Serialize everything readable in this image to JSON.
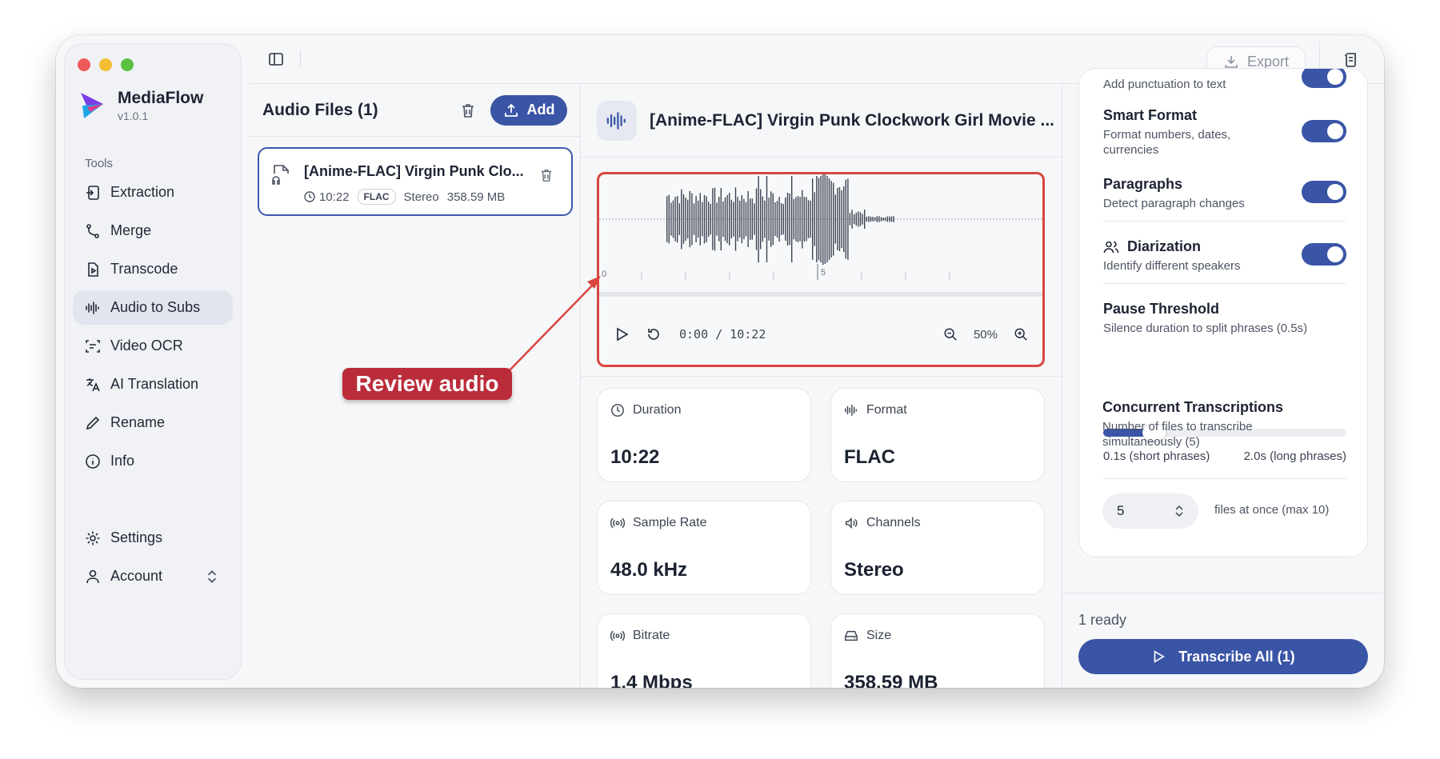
{
  "app": {
    "name": "MediaFlow",
    "version": "v1.0.1"
  },
  "sidebar": {
    "section_label": "Tools",
    "items": [
      {
        "label": "Extraction",
        "icon": "extraction-icon"
      },
      {
        "label": "Merge",
        "icon": "merge-icon"
      },
      {
        "label": "Transcode",
        "icon": "transcode-icon"
      },
      {
        "label": "Audio to Subs",
        "icon": "audio-wave-icon",
        "active": true
      },
      {
        "label": "Video OCR",
        "icon": "scan-text-icon"
      },
      {
        "label": "AI Translation",
        "icon": "translate-icon"
      },
      {
        "label": "Rename",
        "icon": "pencil-icon"
      },
      {
        "label": "Info",
        "icon": "info-icon"
      }
    ],
    "bottom": [
      {
        "label": "Settings",
        "icon": "gear-icon"
      },
      {
        "label": "Account",
        "icon": "user-icon"
      }
    ]
  },
  "toolbar": {
    "export_label": "Export"
  },
  "files_panel": {
    "title": "Audio Files (1)",
    "add_label": "Add",
    "files": [
      {
        "name": "[Anime-FLAC] Virgin Punk Clo...",
        "duration": "10:22",
        "format": "FLAC",
        "channels": "Stereo",
        "size": "358.59 MB"
      }
    ]
  },
  "detail": {
    "title": "[Anime-FLAC] Virgin Punk Clockwork Girl Movie ...",
    "timeline": {
      "tick_start": "0",
      "tick_mark": "5"
    },
    "player": {
      "time": "0:00 / 10:22",
      "zoom": "50%"
    },
    "stats": [
      {
        "label": "Duration",
        "value": "10:22",
        "icon": "clock-icon"
      },
      {
        "label": "Format",
        "value": "FLAC",
        "icon": "audio-wave-icon"
      },
      {
        "label": "Sample Rate",
        "value": "48.0 kHz",
        "icon": "radio-icon"
      },
      {
        "label": "Channels",
        "value": "Stereo",
        "icon": "speaker-icon"
      },
      {
        "label": "Bitrate",
        "value": "1.4 Mbps",
        "icon": "radio-icon"
      },
      {
        "label": "Size",
        "value": "358.59 MB",
        "icon": "drive-icon"
      }
    ]
  },
  "settings": {
    "punctuation_desc": "Add punctuation to text",
    "smart_format": {
      "title": "Smart Format",
      "desc": "Format numbers, dates, currencies",
      "enabled": true
    },
    "paragraphs": {
      "title": "Paragraphs",
      "desc": "Detect paragraph changes",
      "enabled": true
    },
    "diarization": {
      "title": "Diarization",
      "desc": "Identify different speakers",
      "enabled": true
    },
    "pause_threshold": {
      "title": "Pause Threshold",
      "desc": "Silence duration to split phrases (0.5s)",
      "min_label": "0.1s (short phrases)",
      "max_label": "2.0s (long phrases)",
      "value_fraction": 0.21
    },
    "concurrent": {
      "title": "Concurrent Transcriptions",
      "desc": "Number of files to transcribe simultaneously (5)",
      "value": "5",
      "note": "files at once (max 10)"
    }
  },
  "footer": {
    "status": "1 ready",
    "transcribe_label": "Transcribe All (1)"
  },
  "annotation": {
    "label": "Review audio",
    "color": "#bb2c3b"
  },
  "colors": {
    "accent": "#3a55a6",
    "highlight_border": "#d9453e"
  }
}
